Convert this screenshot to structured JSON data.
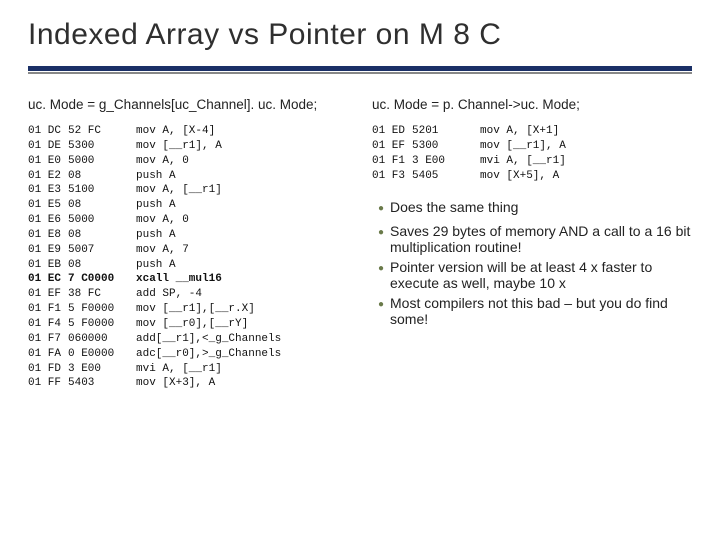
{
  "title": "Indexed Array vs Pointer on M 8 C",
  "left": {
    "caption": "uc. Mode = g_Channels[uc_Channel]. uc. Mode;",
    "rows": [
      {
        "addr": "01 DC",
        "bytes": "52 FC",
        "asm": "mov A, [X-4]"
      },
      {
        "addr": "01 DE",
        "bytes": "5300",
        "asm": "mov [__r1], A"
      },
      {
        "addr": "01 E0",
        "bytes": "5000",
        "asm": "mov A, 0"
      },
      {
        "addr": "01 E2",
        "bytes": "08",
        "asm": "push A"
      },
      {
        "addr": "01 E3",
        "bytes": "5100",
        "asm": "mov A, [__r1]"
      },
      {
        "addr": "01 E5",
        "bytes": "08",
        "asm": "push A"
      },
      {
        "addr": "01 E6",
        "bytes": "5000",
        "asm": "mov A, 0"
      },
      {
        "addr": "01 E8",
        "bytes": "08",
        "asm": "push A"
      },
      {
        "addr": "01 E9",
        "bytes": "5007",
        "asm": "mov A, 7"
      },
      {
        "addr": "01 EB",
        "bytes": "08",
        "asm": "push A"
      },
      {
        "addr": "01 EC",
        "bytes": "7 C0000",
        "asm": "xcall __mul16",
        "bold": true
      },
      {
        "addr": "01 EF",
        "bytes": "38 FC",
        "asm": "add SP, -4"
      },
      {
        "addr": "01 F1",
        "bytes": "5 F0000",
        "asm": "mov [__r1],[__r.X]"
      },
      {
        "addr": "01 F4",
        "bytes": "5 F0000",
        "asm": "mov [__r0],[__rY]"
      },
      {
        "addr": "01 F7",
        "bytes": "060000",
        "asm": "add[__r1],<_g_Channels"
      },
      {
        "addr": "01 FA",
        "bytes": "0 E0000",
        "asm": "adc[__r0],>_g_Channels"
      },
      {
        "addr": "01 FD",
        "bytes": "3 E00",
        "asm": "mvi A, [__r1]"
      },
      {
        "addr": "01 FF",
        "bytes": "5403",
        "asm": "mov [X+3], A"
      }
    ]
  },
  "right": {
    "caption": "uc. Mode = p. Channel->uc. Mode;",
    "rows": [
      {
        "addr": "01 ED",
        "bytes": "5201",
        "asm": "mov A, [X+1]"
      },
      {
        "addr": "01 EF",
        "bytes": "5300",
        "asm": "mov [__r1], A"
      },
      {
        "addr": "01 F1",
        "bytes": "3 E00",
        "asm": "mvi A, [__r1]"
      },
      {
        "addr": "01 F3",
        "bytes": "5405",
        "asm": "mov [X+5], A"
      }
    ],
    "bullets": [
      "Does the same thing",
      "Saves 29 bytes of memory AND a call to a 16 bit multiplication routine!",
      "Pointer version will be at least 4 x faster to execute as well, maybe 10 x",
      "Most compilers not this bad – but you do find some!"
    ]
  }
}
